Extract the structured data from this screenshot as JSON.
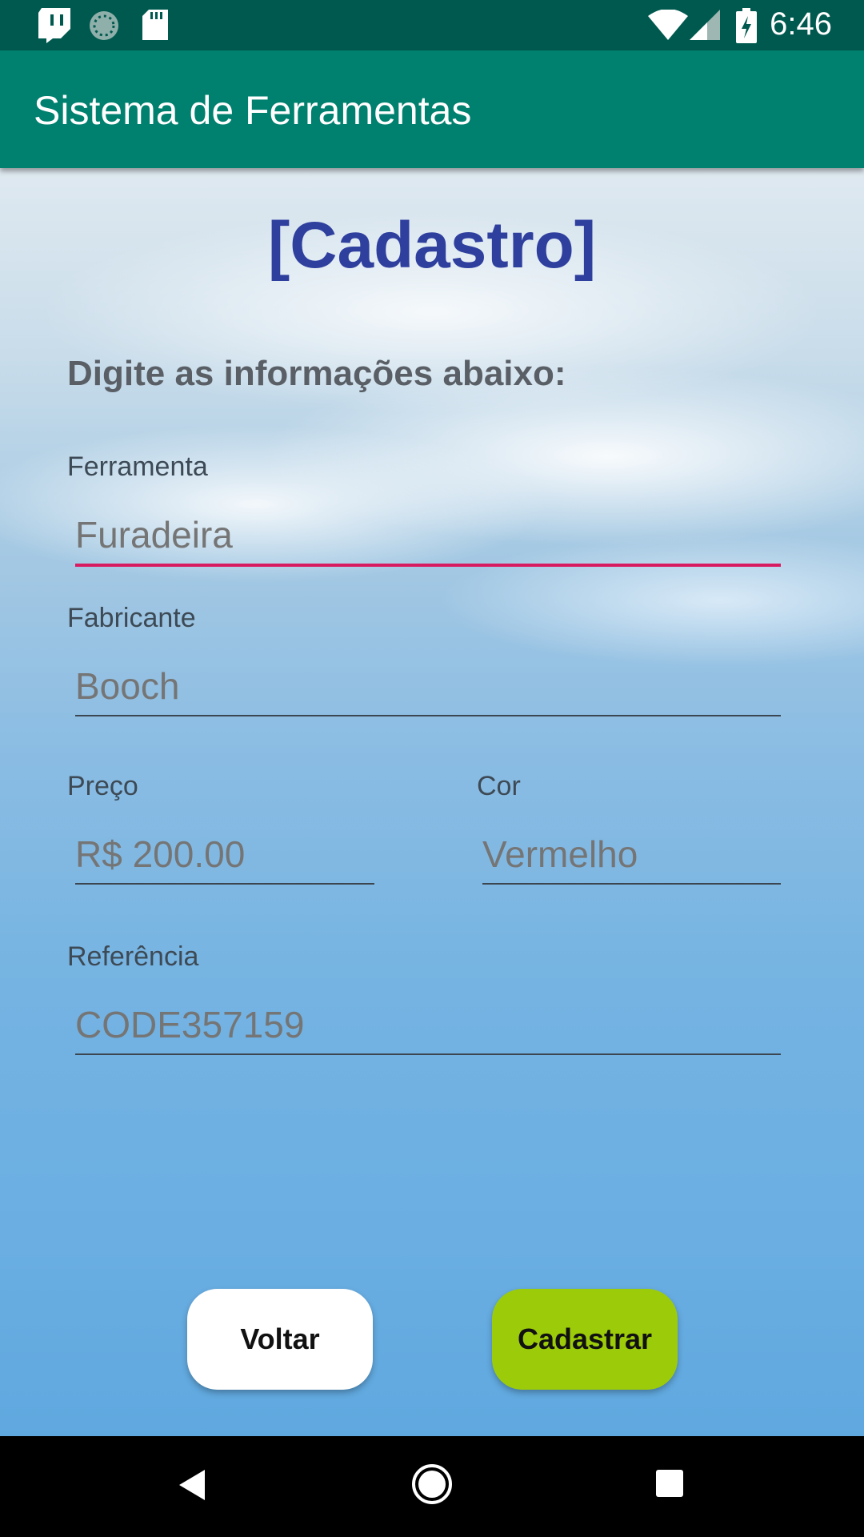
{
  "status_bar": {
    "time": "6:46",
    "left_icons": [
      "twitch-icon",
      "loading-icon",
      "sd-card-icon"
    ],
    "right_icons": [
      "wifi-icon",
      "signal-icon",
      "battery-charging-icon"
    ]
  },
  "app_bar": {
    "title": "Sistema de Ferramentas"
  },
  "form": {
    "heading": "[Cadastro]",
    "instructions": "Digite as informações abaixo:",
    "fields": {
      "ferramenta": {
        "label": "Ferramenta",
        "placeholder": "Furadeira",
        "value": ""
      },
      "fabricante": {
        "label": "Fabricante",
        "placeholder": "Booch",
        "value": ""
      },
      "preco": {
        "label": "Preço",
        "placeholder": "R$ 200.00",
        "value": ""
      },
      "cor": {
        "label": "Cor",
        "placeholder": "Vermelho",
        "value": ""
      },
      "referencia": {
        "label": "Referência",
        "placeholder": "CODE357159",
        "value": ""
      }
    },
    "buttons": {
      "back": "Voltar",
      "submit": "Cadastrar"
    }
  },
  "colors": {
    "status_bar": "#00594f",
    "app_bar": "#00806f",
    "heading": "#2f3f9e",
    "focus_underline": "#d81b60",
    "submit_button": "#9ccc09"
  },
  "nav_bar": {
    "icons": [
      "back-icon",
      "home-icon",
      "recents-icon"
    ]
  }
}
